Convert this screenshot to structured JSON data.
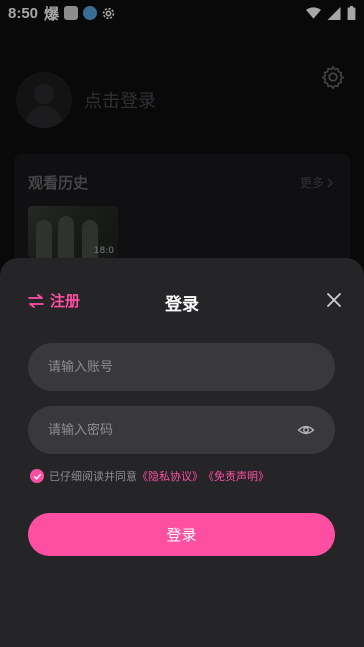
{
  "status_bar": {
    "time": "8:50",
    "app_glyph": "爆",
    "icons": [
      "wifi-icon",
      "signal-icon",
      "battery-icon"
    ]
  },
  "profile": {
    "login_prompt": "点击登录"
  },
  "history": {
    "title": "观看历史",
    "more": "更多",
    "items": [
      {
        "duration": "18:0"
      }
    ]
  },
  "login_sheet": {
    "register_label": "注册",
    "title": "登录",
    "account_placeholder": "请输入账号",
    "password_placeholder": "请输入密码",
    "agree_text": "已仔细阅读并同意",
    "privacy_link": "《隐私协议》",
    "disclaimer_link": "《免责声明》",
    "login_button": "登录"
  },
  "colors": {
    "accent": "#ff4fa3",
    "sheet_bg": "#252527",
    "input_bg": "#39393b"
  }
}
